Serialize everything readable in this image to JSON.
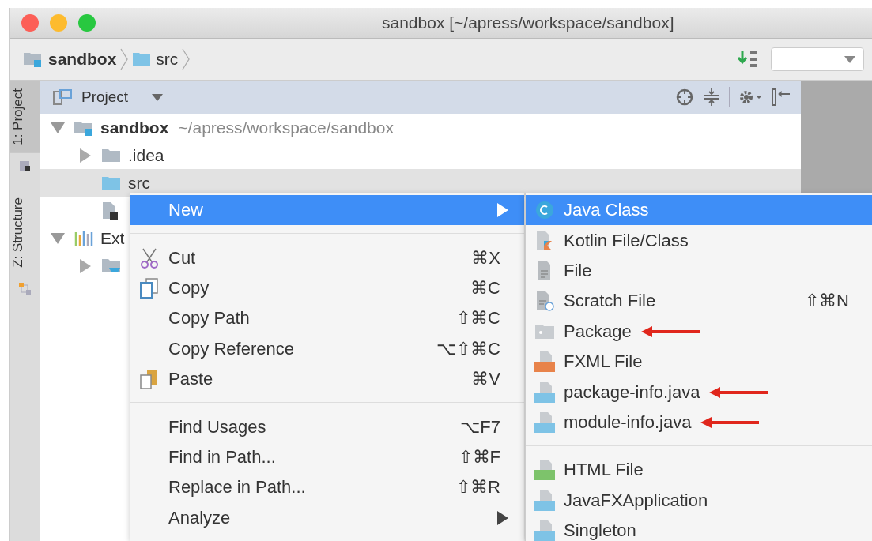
{
  "window": {
    "title": "sandbox [~/apress/workspace/sandbox]"
  },
  "breadcrumb": [
    {
      "label": "sandbox",
      "kind": "module"
    },
    {
      "label": "src",
      "kind": "folder"
    }
  ],
  "side_tabs": [
    {
      "label": "1: Project",
      "selected": true
    },
    {
      "label": "Z: Structure",
      "selected": false
    }
  ],
  "project_panel": {
    "title": "Project"
  },
  "tree": [
    {
      "label": "sandbox",
      "path": "~/apress/workspace/sandbox",
      "kind": "module",
      "expanded": true,
      "selected": false,
      "children": [
        {
          "label": ".idea",
          "kind": "folder",
          "expanded": false,
          "selected": false
        },
        {
          "label": "src",
          "kind": "source",
          "selected": true
        },
        {
          "kind": "file",
          "selected": false
        }
      ]
    },
    {
      "label": "Ext",
      "kind": "libraries",
      "expanded": true,
      "selected": false,
      "children": [
        {
          "kind": "jdk",
          "expanded": false,
          "selected": false
        }
      ]
    }
  ],
  "context_menu": {
    "groups": [
      [
        {
          "label": "New",
          "submenu": true,
          "selected": true,
          "kind": "none"
        }
      ],
      [
        {
          "label": "Cut",
          "shortcut": "⌘X",
          "submenu": false,
          "selected": false,
          "kind": "cut"
        },
        {
          "label": "Copy",
          "shortcut": "⌘C",
          "submenu": false,
          "selected": false,
          "kind": "copy"
        },
        {
          "label": "Copy Path",
          "shortcut": "⇧⌘C",
          "submenu": false,
          "selected": false,
          "kind": "none"
        },
        {
          "label": "Copy Reference",
          "shortcut": "⌥⇧⌘C",
          "submenu": false,
          "selected": false,
          "kind": "none"
        },
        {
          "label": "Paste",
          "shortcut": "⌘V",
          "submenu": false,
          "selected": false,
          "kind": "paste"
        }
      ],
      [
        {
          "label": "Find Usages",
          "shortcut": "⌥F7",
          "submenu": false,
          "selected": false,
          "kind": "none"
        },
        {
          "label": "Find in Path...",
          "shortcut": "⇧⌘F",
          "submenu": false,
          "selected": false,
          "kind": "none"
        },
        {
          "label": "Replace in Path...",
          "shortcut": "⇧⌘R",
          "submenu": false,
          "selected": false,
          "kind": "none"
        },
        {
          "label": "Analyze",
          "submenu": true,
          "selected": false,
          "kind": "none"
        }
      ]
    ]
  },
  "submenu": {
    "groups": [
      [
        {
          "label": "Java Class",
          "selected": true,
          "marked": false,
          "kind": "class"
        },
        {
          "label": "Kotlin File/Class",
          "selected": false,
          "marked": false,
          "kind": "kotlin"
        },
        {
          "label": "File",
          "selected": false,
          "marked": false,
          "kind": "file"
        },
        {
          "label": "Scratch File",
          "shortcut": "⇧⌘N",
          "selected": false,
          "marked": false,
          "kind": "scratch"
        },
        {
          "label": "Package",
          "selected": false,
          "marked": true,
          "kind": "package"
        },
        {
          "label": "FXML File",
          "selected": false,
          "marked": false,
          "kind": "fxml"
        },
        {
          "label": "package-info.java",
          "selected": false,
          "marked": true,
          "kind": "java"
        },
        {
          "label": "module-info.java",
          "selected": false,
          "marked": true,
          "kind": "java"
        }
      ],
      [
        {
          "label": "HTML File",
          "selected": false,
          "marked": false,
          "kind": "html"
        },
        {
          "label": "JavaFXApplication",
          "selected": false,
          "marked": false,
          "kind": "java"
        },
        {
          "label": "Singleton",
          "selected": false,
          "marked": false,
          "kind": "java"
        }
      ]
    ]
  }
}
